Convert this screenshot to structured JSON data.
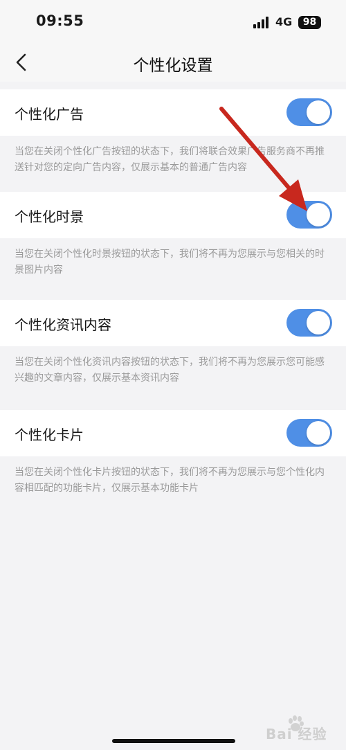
{
  "status_bar": {
    "time": "09:55",
    "network": "4G",
    "battery": "98"
  },
  "header": {
    "back_icon": "chevron-left-icon",
    "title": "个性化设置"
  },
  "settings": [
    {
      "label": "个性化广告",
      "enabled": true,
      "description": "当您在关闭个性化广告按钮的状态下，我们将联合效果广告服务商不再推送针对您的定向广告内容，仅展示基本的普通广告内容"
    },
    {
      "label": "个性化时景",
      "enabled": true,
      "description": "当您在关闭个性化时景按钮的状态下，我们将不再为您展示与您相关的时景图片内容"
    },
    {
      "label": "个性化资讯内容",
      "enabled": true,
      "description": "当您在关闭个性化资讯内容按钮的状态下，我们将不再为您展示您可能感兴趣的文章内容，仅展示基本资讯内容"
    },
    {
      "label": "个性化卡片",
      "enabled": true,
      "description": "当您在关闭个性化卡片按钮的状态下，我们将不再为您展示与您个性化内容相匹配的功能卡片，仅展示基本功能卡片"
    }
  ],
  "colors": {
    "toggle_on": "#4f8fe6",
    "annotation_arrow": "#c8281e",
    "background": "#f3f3f5"
  },
  "watermark": {
    "text": "Bai 经验"
  }
}
